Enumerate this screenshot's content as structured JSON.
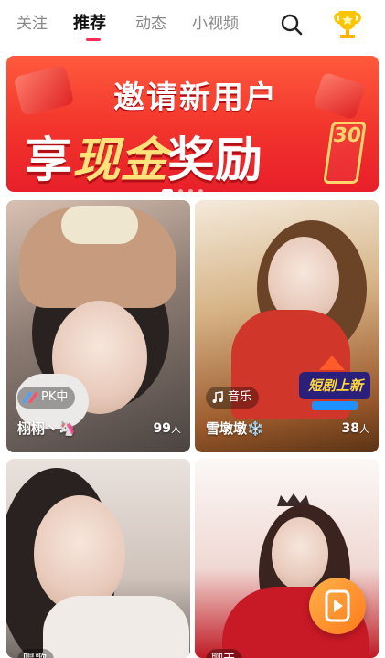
{
  "tabs": [
    {
      "label": "关注",
      "active": false
    },
    {
      "label": "推荐",
      "active": true
    },
    {
      "label": "动态",
      "active": false
    },
    {
      "label": "小视频",
      "active": false
    }
  ],
  "header_icons": [
    "search-icon",
    "trophy-icon"
  ],
  "banner": {
    "line1": "邀请新用户",
    "line2_prefix": "享",
    "line2_highlight": "现金",
    "line2_suffix": "奖励",
    "badge": "30"
  },
  "cards": [
    {
      "tag_icon": "pk-icon",
      "tag": "PK中",
      "name": "栩栩丶🦄",
      "count": "99",
      "unit": "人"
    },
    {
      "tag_icon": "music-note-icon",
      "tag": "音乐",
      "name": "雪墩墩❄️",
      "count": "38",
      "unit": "人",
      "badge": "短剧上新"
    },
    {
      "tag_icon": "",
      "tag": "唱歌",
      "name": "",
      "count": "",
      "unit": ""
    },
    {
      "tag_icon": "",
      "tag": "聊天",
      "name": "",
      "count": "",
      "unit": ""
    }
  ],
  "colors": {
    "accent": "#ff2d55",
    "banner": "#f2332c",
    "gold": "#ffd66b"
  }
}
